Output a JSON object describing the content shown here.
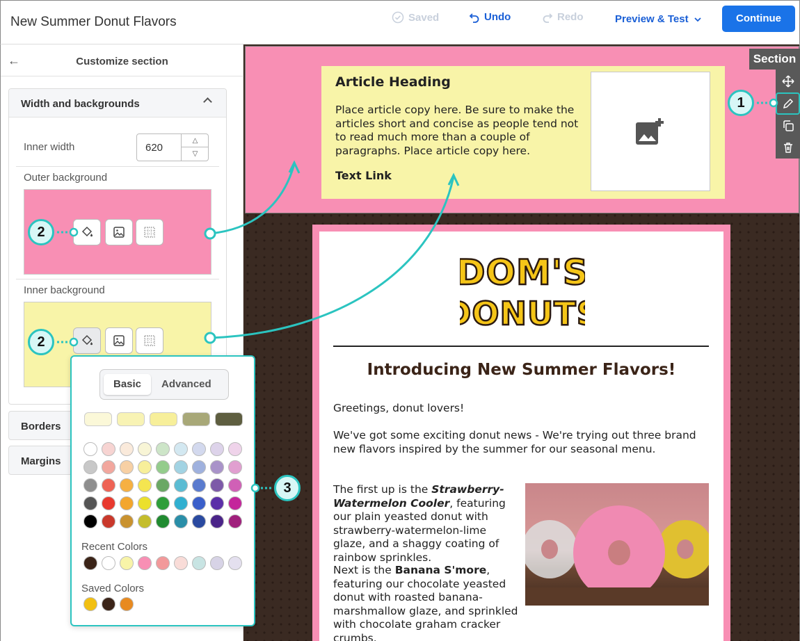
{
  "header": {
    "title": "New Summer Donut Flavors",
    "saved_label": "Saved",
    "undo_label": "Undo",
    "redo_label": "Redo",
    "preview_label": "Preview & Test",
    "continue_label": "Continue"
  },
  "sidebar": {
    "title": "Customize section",
    "panel_title": "Width and backgrounds",
    "inner_width_label": "Inner width",
    "inner_width_value": "620",
    "outer_bg_label": "Outer background",
    "outer_bg_color": "#f88fb4",
    "inner_bg_label": "Inner background",
    "inner_bg_color": "#f8f4a8",
    "borders_label": "Borders",
    "margins_label": "Margins"
  },
  "picker": {
    "tab_basic": "Basic",
    "tab_advanced": "Advanced",
    "recent_label": "Recent Colors",
    "saved_label": "Saved Colors",
    "tints": [
      "#fbf8d8",
      "#f8f3b4",
      "#f7ef9a",
      "#a8a878",
      "#5e5e40"
    ],
    "grid": [
      [
        "#ffffff",
        "#f7d4d2",
        "#faeadb",
        "#f8f5d6",
        "#cde5c8",
        "#d3e8f1",
        "#d3d9ee",
        "#ddd3ea",
        "#efd3ea"
      ],
      [
        "#c8c8c8",
        "#f2a79e",
        "#f7d0a4",
        "#f7ef9a",
        "#94cc8c",
        "#a2d3e3",
        "#9fb1de",
        "#a993c9",
        "#e19fd0"
      ],
      [
        "#8e8e8e",
        "#ee6355",
        "#f6b042",
        "#f4e550",
        "#6aa864",
        "#5bbcd3",
        "#5a7bce",
        "#7d5aa8",
        "#d060b6"
      ],
      [
        "#555555",
        "#e8392e",
        "#f3a62d",
        "#ebe02c",
        "#2f9e3a",
        "#31afd0",
        "#3a5fca",
        "#5b2fa8",
        "#c4259b"
      ],
      [
        "#000000",
        "#c9382b",
        "#c99230",
        "#c4bd2c",
        "#208a30",
        "#2a8ea8",
        "#2a4aa0",
        "#4a2488",
        "#a0207c"
      ]
    ],
    "recent": [
      "#3b2418",
      "#ffffff",
      "#f8f4a8",
      "#f88fb4",
      "#f2999a",
      "#f9dcd8",
      "#c8e4e3",
      "#d7d3e6",
      "#e4e0ef"
    ],
    "saved": [
      "#f2c012",
      "#3b2418",
      "#e88a20"
    ]
  },
  "canvas": {
    "section_label": "Section",
    "article_heading": "Article Heading",
    "article_copy": "Place article copy here. Be sure to make the articles short and concise as people tend not to read much more than a couple of paragraphs. Place article copy here.",
    "article_link": "Text Link",
    "logo_line1": "DOM'S",
    "logo_line2": "DONUTS",
    "email_heading": "Introducing New Summer Flavors!",
    "greeting": "Greetings, donut lovers!",
    "intro": "We've got some exciting donut news - We're trying out three brand new flavors inspired by the summer for our seasonal menu.",
    "p1_start": "The first up is the ",
    "p1_bold": "Strawberry-Watermelon Cooler",
    "p1_end": ", featuring our plain yeasted donut with strawberry-watermelon-lime glaze, and a shaggy coating of rainbow sprinkles.",
    "p2_start": "Next is the ",
    "p2_bold": "Banana S'more",
    "p2_end": ", featuring our chocolate yeasted donut with roasted banana-marshmallow glaze, and sprinkled with chocolate graham cracker crumbs."
  },
  "callouts": {
    "one": "1",
    "two_a": "2",
    "two_b": "2",
    "three": "3"
  },
  "colors": {
    "accent": "#1a73e8",
    "callout": "#2bc4c0"
  }
}
